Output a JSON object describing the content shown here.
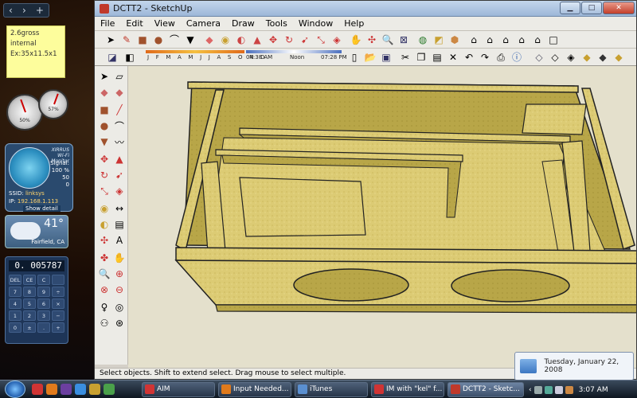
{
  "desktop": {
    "sticky_note": [
      "2.6gross",
      "internal",
      "Ex:35x11.5x1"
    ],
    "gauge1_pct": "50%",
    "gauge2_pct": "57%",
    "wifi": {
      "brand": "XIRRUS Wi-Fi Monitor",
      "signal_label": "Signal:",
      "signal_value": "100 %",
      "scale_50": "50",
      "scale_0": "0",
      "ssid_label": "SSID:",
      "ssid_value": "linksys",
      "ip_label": "IP:",
      "ip_value": "192.168.1.113",
      "show_detail": "Show detail"
    },
    "weather": {
      "temp": "41°",
      "city": "Fairfield, CA"
    },
    "calculator": {
      "display": "0. 005787",
      "keys": [
        "DEL",
        "CE",
        "C",
        "",
        "7",
        "8",
        "9",
        "÷",
        "4",
        "5",
        "6",
        "×",
        "1",
        "2",
        "3",
        "−",
        "0",
        "±",
        ".",
        "+"
      ]
    }
  },
  "window": {
    "title": "DCTT2 - SketchUp",
    "menu": [
      "File",
      "Edit",
      "View",
      "Camera",
      "Draw",
      "Tools",
      "Window",
      "Help"
    ],
    "shadow_months": "J F M A M J J A S O N D",
    "time_start": "04:38 AM",
    "time_mid": "Noon",
    "time_end": "07:28 PM",
    "status": "Select objects. Shift to extend select. Drag mouse to select multiple."
  },
  "date_popup": {
    "text": "Tuesday, January 22, 2008"
  },
  "taskbar": {
    "tasks": [
      "AIM",
      "Input Needed...",
      "iTunes",
      "IM with \"kel\" f...",
      "DCTT2 - Sketc..."
    ],
    "clock": "3:07 AM"
  },
  "colors": {
    "wood": "#d8c870",
    "wood_dark": "#a8963a",
    "titlebar": "#b6cbe6",
    "taskbar": "#1e2b3a"
  }
}
